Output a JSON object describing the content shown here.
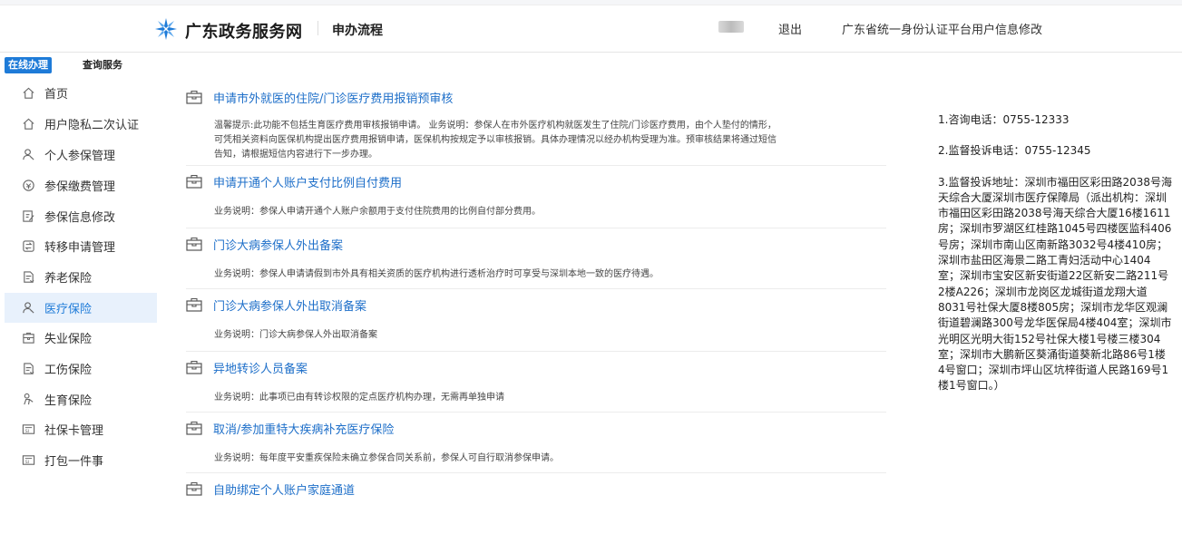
{
  "header": {
    "site_name": "广东政务服务网",
    "page_title": "申办流程",
    "logout": "退出",
    "profile_link": "广东省统一身份认证平台用户信息修改"
  },
  "tabs": [
    {
      "label": "在线办理",
      "active": true
    },
    {
      "label": "查询服务",
      "active": false
    }
  ],
  "sidebar": {
    "items": [
      {
        "label": "首页",
        "icon": "home-icon"
      },
      {
        "label": "用户隐私二次认证",
        "icon": "home-icon"
      },
      {
        "label": "个人参保管理",
        "icon": "user-icon"
      },
      {
        "label": "参保缴费管理",
        "icon": "payment-icon"
      },
      {
        "label": "参保信息修改",
        "icon": "edit-icon"
      },
      {
        "label": "转移申请管理",
        "icon": "transfer-icon"
      },
      {
        "label": "养老保险",
        "icon": "document-icon"
      },
      {
        "label": "医疗保险",
        "icon": "user-icon",
        "active": true
      },
      {
        "label": "失业保险",
        "icon": "briefcase-icon"
      },
      {
        "label": "工伤保险",
        "icon": "document-icon"
      },
      {
        "label": "生育保险",
        "icon": "baby-icon"
      },
      {
        "label": "社保卡管理",
        "icon": "card-icon"
      },
      {
        "label": "打包一件事",
        "icon": "card-icon"
      }
    ]
  },
  "services": [
    {
      "title": "申请市外就医的住院/门诊医疗费用报销预审核",
      "desc": [
        "温馨提示:此功能不包括生育医疗费用审核报销申请。 业务说明：参保人在市外医疗机构就医发生了住院/门诊医疗费用，由个人垫付的情形，",
        "可凭相关资料向医保机构提出医疗费用报销申请，医保机构按规定予以审核报销。具体办理情况以经办机构受理为准。预审核结果将通过短信",
        "告知，请根据短信内容进行下一步办理。"
      ]
    },
    {
      "title": "申请开通个人账户支付比例自付费用",
      "desc": [
        "业务说明：参保人申请开通个人账户余额用于支付住院费用的比例自付部分费用。"
      ]
    },
    {
      "title": "门诊大病参保人外出备案",
      "desc": [
        "业务说明：参保人申请请假到市外具有相关资质的医疗机构进行透析治疗时可享受与深圳本地一致的医疗待遇。"
      ]
    },
    {
      "title": "门诊大病参保人外出取消备案",
      "desc": [
        "业务说明：门诊大病参保人外出取消备案"
      ]
    },
    {
      "title": "异地转诊人员备案",
      "desc": [
        "业务说明：此事项已由有转诊权限的定点医疗机构办理，无需再单独申请"
      ]
    },
    {
      "title": "取消/参加重特大疾病补充医疗保险",
      "desc": [
        "业务说明：每年度平安重疾保险未确立参保合同关系前，参保人可自行取消参保申请。"
      ]
    },
    {
      "title": "自助绑定个人账户家庭通道",
      "desc": []
    }
  ],
  "info_panel": {
    "consult_phone": "1.咨询电话：0755-12333",
    "complaint_phone": "2.监督投诉电话：0755-12345",
    "complaint_address": "3.监督投诉地址：深圳市福田区彩田路2038号海天综合大厦深圳市医疗保障局（派出机构：深圳市福田区彩田路2038号海天综合大厦16楼1611房；深圳市罗湖区红桂路1045号四楼医监科406号房；深圳市南山区南新路3032号4楼410房；深圳市盐田区海景二路工青妇活动中心1404室；深圳市宝安区新安街道22区新安二路211号2楼A226；深圳市龙岗区龙城街道龙翔大道8031号社保大厦8楼805房；深圳市龙华区观澜街道碧澜路300号龙华医保局4楼404室；深圳市光明区光明大街152号社保大楼1号楼三楼304室；深圳市大鹏新区葵涌街道葵新北路86号1楼4号窗口；深圳市坪山区坑梓街道人民路169号1楼1号窗口。）"
  },
  "colors": {
    "brand_blue": "#1e7bd8",
    "link_blue": "#1e6fc9",
    "active_bg": "#e8f1fc"
  }
}
